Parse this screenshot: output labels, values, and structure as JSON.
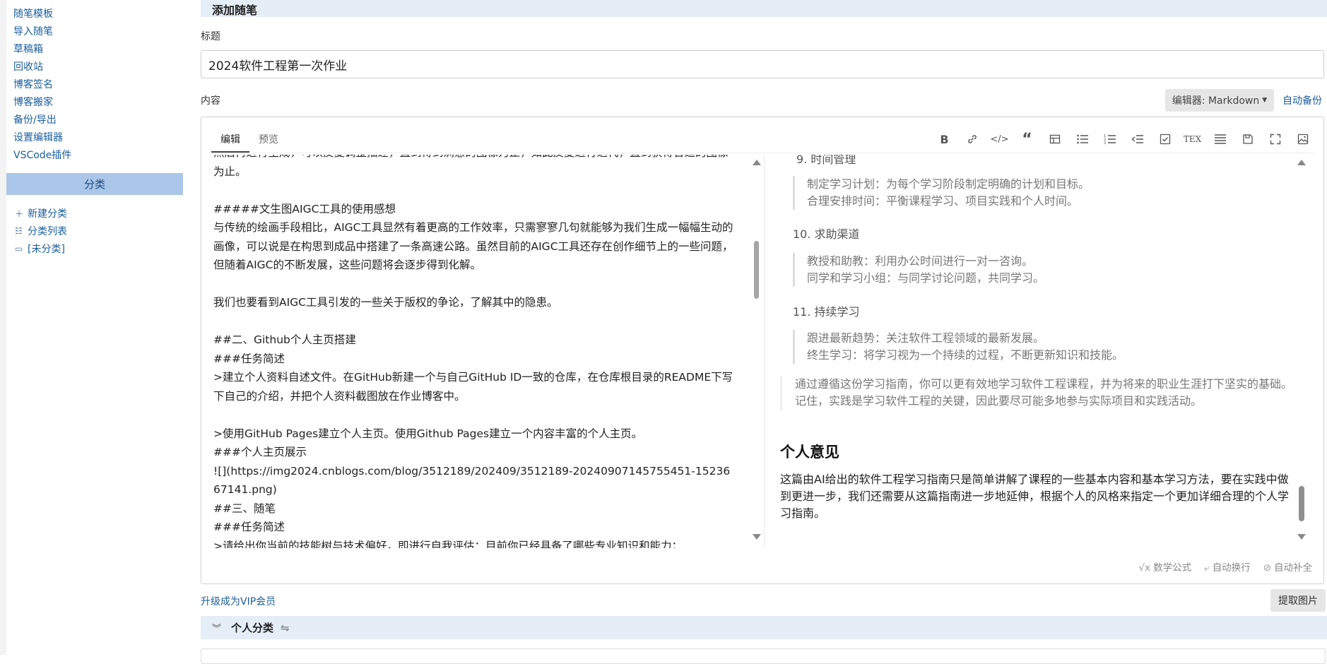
{
  "sidebar": {
    "links": [
      "随笔模板",
      "导入随笔",
      "草稿箱",
      "回收站",
      "博客签名",
      "博客搬家",
      "备份/导出",
      "设置编辑器",
      "VSCode插件"
    ],
    "category_header": "分类",
    "category_links": [
      {
        "icon": "plus-icon",
        "label": "新建分类"
      },
      {
        "icon": "list-icon",
        "label": "分类列表"
      },
      {
        "icon": "folder-icon",
        "label": "[未分类]"
      }
    ]
  },
  "page": {
    "header": "添加随笔",
    "title_label": "标题",
    "title_value": "2024软件工程第一次作业",
    "content_label": "内容",
    "editor_select": "编辑器: Markdown",
    "auto_backup": "自动备份"
  },
  "editor": {
    "tabs": [
      "编辑",
      "预览"
    ],
    "toolbar": [
      "bold-icon",
      "link-icon",
      "code-icon",
      "quote-icon",
      "table-icon",
      "bullet-list-icon",
      "ordered-list-icon",
      "outdent-icon",
      "task-list-icon",
      "tex-icon",
      "justify-icon",
      "save-icon",
      "fullscreen-icon",
      "image-icon"
    ],
    "source_text": "然后再进行生成，可以反复调整描述，直到得到满意的图像为止，如此反复进行迭代，直到获得合适的图像为止。\n\n#####文生图AIGC工具的使用感想\n与传统的绘画手段相比，AIGC工具显然有着更高的工作效率，只需寥寥几句就能够为我们生成一幅幅生动的画像，可以说是在构思到成品中搭建了一条高速公路。虽然目前的AIGC工具还存在创作细节上的一些问题，但随着AIGC的不断发展，这些问题将会逐步得到化解。\n\n我们也要看到AIGC工具引发的一些关于版权的争论，了解其中的隐患。\n\n##二、Github个人主页搭建\n###任务简述\n>建立个人资料自述文件。在GitHub新建一个与自己GitHub ID一致的仓库，在仓库根目录的README下写下自己的介绍，并把个人资料截图放在作业博客中。\n\n>使用GitHub Pages建立个人主页。使用Github Pages建立一个内容丰富的个人主页。\n###个人主页展示\n![](https://img2024.cnblogs.com/blog/3512189/202409/3512189-20240907145755451-1523667141.png)\n##三、随笔\n###任务简述\n>请给出你当前的技能树与技术偏好，即进行自我评估：目前你已经具备了哪些专业知识和能力；",
    "preview": {
      "item9": "9. 时间管理",
      "quote9": [
        "制定学习计划：为每个学习阶段制定明确的计划和目标。",
        "合理安排时间：平衡课程学习、项目实践和个人时间。"
      ],
      "item10": "10. 求助渠道",
      "quote10": [
        "教授和助教：利用办公时间进行一对一咨询。",
        "同学和学习小组：与同学讨论问题，共同学习。"
      ],
      "item11": "11. 持续学习",
      "quote11": [
        "跟进最新趋势：关注软件工程领域的最新发展。",
        "终生学习：将学习视为一个持续的过程，不断更新知识和技能。"
      ],
      "summary": "通过遵循这份学习指南，你可以更有效地学习软件工程课程，并为将来的职业生涯打下坚实的基础。记住，实践是学习软件工程的关键，因此要尽可能多地参与实际项目和实践活动。",
      "heading": "个人意见",
      "opinion": "这篇由AI给出的软件工程学习指南只是简单讲解了课程的一些基本内容和基本学习方法，要在实践中做到更进一步，我们还需要从这篇指南进一步地延伸，根据个人的风格来指定一个更加详细合理的个人学习指南。"
    },
    "bottom_tools": [
      "数学公式",
      "自动换行",
      "自动补全"
    ]
  },
  "footer": {
    "vip": "升级成为VIP会员",
    "extract": "提取图片",
    "section_title": "个人分类"
  }
}
